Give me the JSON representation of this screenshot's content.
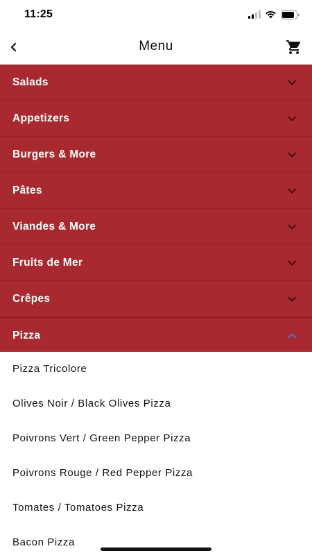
{
  "status_bar": {
    "time": "11:25"
  },
  "nav": {
    "title": "Menu",
    "back_icon": "chevron-left-icon",
    "cart_icon": "shopping-cart-icon"
  },
  "colors": {
    "category_background": "#a82930",
    "expanded_chevron": "#4a7fd6",
    "collapsed_chevron": "#3a0a0e"
  },
  "categories": [
    {
      "label": "Salads",
      "expanded": false
    },
    {
      "label": "Appetizers",
      "expanded": false
    },
    {
      "label": "Burgers & More",
      "expanded": false
    },
    {
      "label": "Pâtes",
      "expanded": false
    },
    {
      "label": "Viandes & More",
      "expanded": false
    },
    {
      "label": "Fruits de Mer",
      "expanded": false
    },
    {
      "label": "Crêpes",
      "expanded": false
    },
    {
      "label": "Pizza",
      "expanded": true
    }
  ],
  "pizza_items": [
    "Pizza Tricolore",
    "Olives Noir / Black Olives Pizza",
    "Poivrons Vert / Green Pepper Pizza",
    "Poivrons Rouge / Red Pepper Pizza",
    "Tomates / Tomatoes Pizza",
    "Bacon Pizza"
  ]
}
